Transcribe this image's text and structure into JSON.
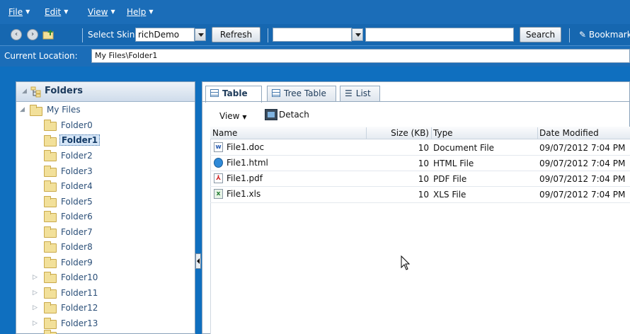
{
  "menubar": {
    "items": [
      {
        "label": "File"
      },
      {
        "label": "Edit"
      },
      {
        "label": "View"
      },
      {
        "label": "Help"
      }
    ]
  },
  "toolbar": {
    "select_skin_label": "Select Skin",
    "skin_value": "richDemo",
    "refresh_label": "Refresh",
    "search_scope_value": "",
    "search_value": "",
    "search_label": "Search",
    "bookmark_label": "Bookmark"
  },
  "location": {
    "label": "Current Location:",
    "value": "My Files\\Folder1"
  },
  "folders_panel": {
    "title": "Folders",
    "root": "My Files",
    "items": [
      {
        "label": "Folder0",
        "expandable": false,
        "selected": false
      },
      {
        "label": "Folder1",
        "expandable": false,
        "selected": true
      },
      {
        "label": "Folder2",
        "expandable": false,
        "selected": false
      },
      {
        "label": "Folder3",
        "expandable": false,
        "selected": false
      },
      {
        "label": "Folder4",
        "expandable": false,
        "selected": false
      },
      {
        "label": "Folder5",
        "expandable": false,
        "selected": false
      },
      {
        "label": "Folder6",
        "expandable": false,
        "selected": false
      },
      {
        "label": "Folder7",
        "expandable": false,
        "selected": false
      },
      {
        "label": "Folder8",
        "expandable": false,
        "selected": false
      },
      {
        "label": "Folder9",
        "expandable": false,
        "selected": false
      },
      {
        "label": "Folder10",
        "expandable": true,
        "selected": false
      },
      {
        "label": "Folder11",
        "expandable": true,
        "selected": false
      },
      {
        "label": "Folder12",
        "expandable": true,
        "selected": false
      },
      {
        "label": "Folder13",
        "expandable": true,
        "selected": false
      }
    ]
  },
  "content": {
    "tabs": [
      {
        "label": "Table",
        "active": true
      },
      {
        "label": "Tree Table",
        "active": false
      },
      {
        "label": "List",
        "active": false
      }
    ],
    "view_menu_label": "View",
    "detach_label": "Detach",
    "columns": [
      "Name",
      "Size (KB)",
      "Type",
      "Date Modified"
    ],
    "rows": [
      {
        "name": "File1.doc",
        "size": "10",
        "type": "Document File",
        "date": "09/07/2012 7:04 PM",
        "icon": "word-doc-icon"
      },
      {
        "name": "File1.html",
        "size": "10",
        "type": "HTML File",
        "date": "09/07/2012 7:04 PM",
        "icon": "html-file-icon"
      },
      {
        "name": "File1.pdf",
        "size": "10",
        "type": "PDF File",
        "date": "09/07/2012 7:04 PM",
        "icon": "pdf-file-icon"
      },
      {
        "name": "File1.xls",
        "size": "10",
        "type": "XLS File",
        "date": "09/07/2012 7:04 PM",
        "icon": "excel-file-icon"
      }
    ]
  },
  "colors": {
    "chrome_blue": "#1b6db8",
    "folder_yellow": "#f2e09a",
    "selection": "#d6e6f7"
  }
}
